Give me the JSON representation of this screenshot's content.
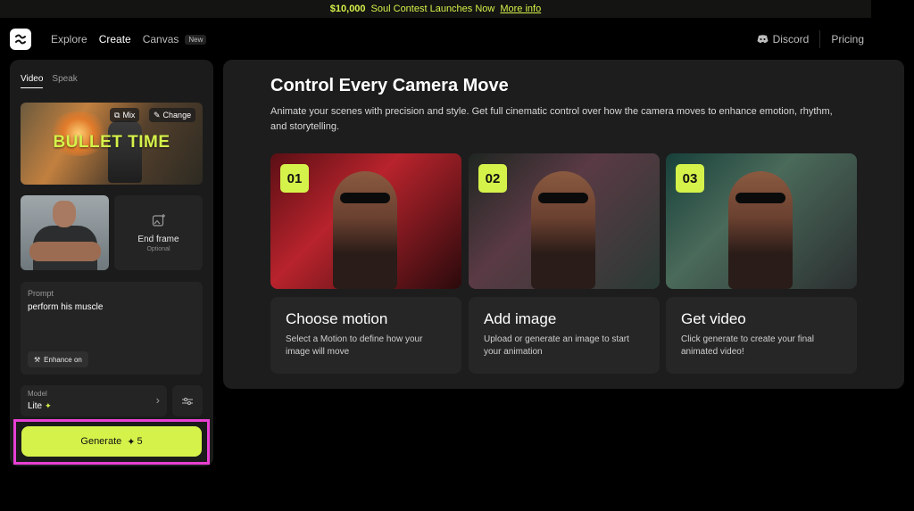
{
  "banner": {
    "amount": "$10,000",
    "text": "Soul Contest Launches Now",
    "link": "More info"
  },
  "nav": {
    "links": [
      "Explore",
      "Create",
      "Canvas"
    ],
    "new_badge": "New",
    "discord": "Discord",
    "pricing": "Pricing"
  },
  "left": {
    "tabs": [
      "Video",
      "Speak"
    ],
    "motion": {
      "title": "BULLET TIME",
      "mix_label": "Mix",
      "change_label": "Change"
    },
    "end_frame": {
      "label": "End frame",
      "sub": "Optional"
    },
    "prompt": {
      "label": "Prompt",
      "text": "perform his muscle",
      "enhance": "Enhance on"
    },
    "model": {
      "label": "Model",
      "value": "Lite"
    },
    "generate": {
      "label": "Generate",
      "credits": "5"
    }
  },
  "right": {
    "title": "Control Every Camera Move",
    "description": "Animate your scenes with precision and style. Get full cinematic control over how the camera moves to enhance emotion, rhythm, and storytelling.",
    "steps": [
      {
        "num": "01",
        "title": "Choose motion",
        "desc": "Select a Motion to define how your image will move"
      },
      {
        "num": "02",
        "title": "Add image",
        "desc": "Upload or generate an image to start your animation"
      },
      {
        "num": "03",
        "title": "Get video",
        "desc": "Click generate to create your final animated video!"
      }
    ]
  },
  "colors": {
    "accent": "#d5f24a",
    "highlight": "#e83fd3",
    "panel": "#1b1b1b"
  }
}
